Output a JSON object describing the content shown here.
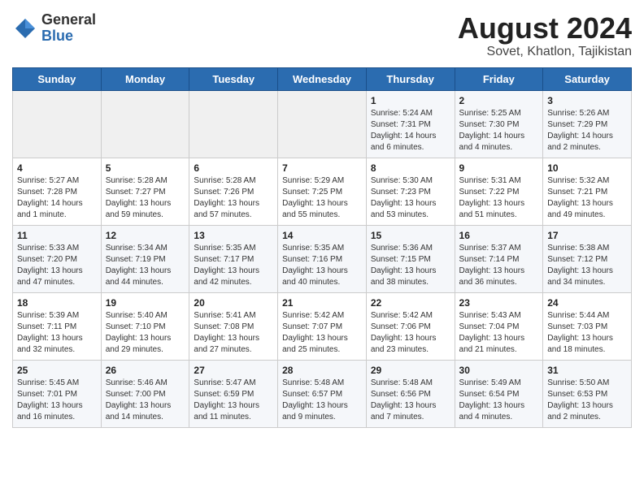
{
  "header": {
    "logo_line1": "General",
    "logo_line2": "Blue",
    "title": "August 2024",
    "subtitle": "Sovet, Khatlon, Tajikistan"
  },
  "weekdays": [
    "Sunday",
    "Monday",
    "Tuesday",
    "Wednesday",
    "Thursday",
    "Friday",
    "Saturday"
  ],
  "weeks": [
    [
      {
        "day": "",
        "info": ""
      },
      {
        "day": "",
        "info": ""
      },
      {
        "day": "",
        "info": ""
      },
      {
        "day": "",
        "info": ""
      },
      {
        "day": "1",
        "info": "Sunrise: 5:24 AM\nSunset: 7:31 PM\nDaylight: 14 hours\nand 6 minutes."
      },
      {
        "day": "2",
        "info": "Sunrise: 5:25 AM\nSunset: 7:30 PM\nDaylight: 14 hours\nand 4 minutes."
      },
      {
        "day": "3",
        "info": "Sunrise: 5:26 AM\nSunset: 7:29 PM\nDaylight: 14 hours\nand 2 minutes."
      }
    ],
    [
      {
        "day": "4",
        "info": "Sunrise: 5:27 AM\nSunset: 7:28 PM\nDaylight: 14 hours\nand 1 minute."
      },
      {
        "day": "5",
        "info": "Sunrise: 5:28 AM\nSunset: 7:27 PM\nDaylight: 13 hours\nand 59 minutes."
      },
      {
        "day": "6",
        "info": "Sunrise: 5:28 AM\nSunset: 7:26 PM\nDaylight: 13 hours\nand 57 minutes."
      },
      {
        "day": "7",
        "info": "Sunrise: 5:29 AM\nSunset: 7:25 PM\nDaylight: 13 hours\nand 55 minutes."
      },
      {
        "day": "8",
        "info": "Sunrise: 5:30 AM\nSunset: 7:23 PM\nDaylight: 13 hours\nand 53 minutes."
      },
      {
        "day": "9",
        "info": "Sunrise: 5:31 AM\nSunset: 7:22 PM\nDaylight: 13 hours\nand 51 minutes."
      },
      {
        "day": "10",
        "info": "Sunrise: 5:32 AM\nSunset: 7:21 PM\nDaylight: 13 hours\nand 49 minutes."
      }
    ],
    [
      {
        "day": "11",
        "info": "Sunrise: 5:33 AM\nSunset: 7:20 PM\nDaylight: 13 hours\nand 47 minutes."
      },
      {
        "day": "12",
        "info": "Sunrise: 5:34 AM\nSunset: 7:19 PM\nDaylight: 13 hours\nand 44 minutes."
      },
      {
        "day": "13",
        "info": "Sunrise: 5:35 AM\nSunset: 7:17 PM\nDaylight: 13 hours\nand 42 minutes."
      },
      {
        "day": "14",
        "info": "Sunrise: 5:35 AM\nSunset: 7:16 PM\nDaylight: 13 hours\nand 40 minutes."
      },
      {
        "day": "15",
        "info": "Sunrise: 5:36 AM\nSunset: 7:15 PM\nDaylight: 13 hours\nand 38 minutes."
      },
      {
        "day": "16",
        "info": "Sunrise: 5:37 AM\nSunset: 7:14 PM\nDaylight: 13 hours\nand 36 minutes."
      },
      {
        "day": "17",
        "info": "Sunrise: 5:38 AM\nSunset: 7:12 PM\nDaylight: 13 hours\nand 34 minutes."
      }
    ],
    [
      {
        "day": "18",
        "info": "Sunrise: 5:39 AM\nSunset: 7:11 PM\nDaylight: 13 hours\nand 32 minutes."
      },
      {
        "day": "19",
        "info": "Sunrise: 5:40 AM\nSunset: 7:10 PM\nDaylight: 13 hours\nand 29 minutes."
      },
      {
        "day": "20",
        "info": "Sunrise: 5:41 AM\nSunset: 7:08 PM\nDaylight: 13 hours\nand 27 minutes."
      },
      {
        "day": "21",
        "info": "Sunrise: 5:42 AM\nSunset: 7:07 PM\nDaylight: 13 hours\nand 25 minutes."
      },
      {
        "day": "22",
        "info": "Sunrise: 5:42 AM\nSunset: 7:06 PM\nDaylight: 13 hours\nand 23 minutes."
      },
      {
        "day": "23",
        "info": "Sunrise: 5:43 AM\nSunset: 7:04 PM\nDaylight: 13 hours\nand 21 minutes."
      },
      {
        "day": "24",
        "info": "Sunrise: 5:44 AM\nSunset: 7:03 PM\nDaylight: 13 hours\nand 18 minutes."
      }
    ],
    [
      {
        "day": "25",
        "info": "Sunrise: 5:45 AM\nSunset: 7:01 PM\nDaylight: 13 hours\nand 16 minutes."
      },
      {
        "day": "26",
        "info": "Sunrise: 5:46 AM\nSunset: 7:00 PM\nDaylight: 13 hours\nand 14 minutes."
      },
      {
        "day": "27",
        "info": "Sunrise: 5:47 AM\nSunset: 6:59 PM\nDaylight: 13 hours\nand 11 minutes."
      },
      {
        "day": "28",
        "info": "Sunrise: 5:48 AM\nSunset: 6:57 PM\nDaylight: 13 hours\nand 9 minutes."
      },
      {
        "day": "29",
        "info": "Sunrise: 5:48 AM\nSunset: 6:56 PM\nDaylight: 13 hours\nand 7 minutes."
      },
      {
        "day": "30",
        "info": "Sunrise: 5:49 AM\nSunset: 6:54 PM\nDaylight: 13 hours\nand 4 minutes."
      },
      {
        "day": "31",
        "info": "Sunrise: 5:50 AM\nSunset: 6:53 PM\nDaylight: 13 hours\nand 2 minutes."
      }
    ]
  ]
}
